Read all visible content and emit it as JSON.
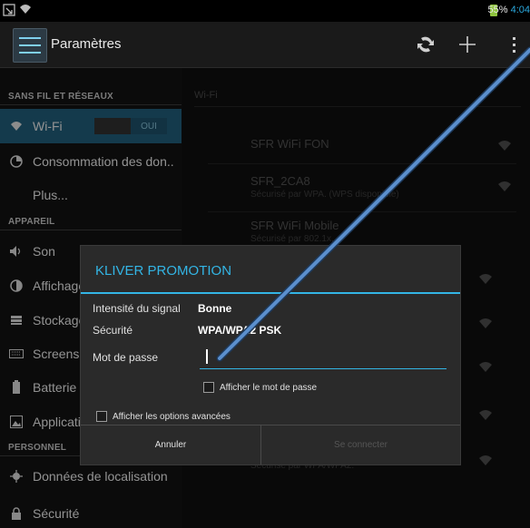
{
  "status_bar": {
    "battery": "55%",
    "time": "4:04"
  },
  "action_bar": {
    "title": "Paramètres",
    "icons": [
      "settings-app-icon",
      "sync-icon",
      "add-icon",
      "overflow-menu-icon"
    ]
  },
  "left_pane": {
    "section_wireless": "SANS FIL ET RÉSEAUX",
    "wifi_label": "Wi-Fi",
    "wifi_toggle": "OUI",
    "data_usage": "Consommation des don..",
    "more": "Plus...",
    "section_device": "APPAREIL",
    "sound": "Son",
    "display": "Affichage",
    "storage": "Stockage",
    "screenshot": "Screenshot",
    "battery": "Batterie",
    "apps": "Applications",
    "section_personal": "PERSONNEL",
    "location": "Données de localisation",
    "security": "Sécurité"
  },
  "right_pane": {
    "header": "Wi-Fi",
    "networks": [
      {
        "name": "SFR WiFi FON",
        "sub": ""
      },
      {
        "name": "SFR_2CA8",
        "sub": "Sécurisé par WPA. (WPS disponible)"
      },
      {
        "name": "SFR WiFi Mobile",
        "sub": "Sécurisé par 802.1x."
      },
      {
        "name": "",
        "sub": "Sécurisé par WPA/WPA2."
      }
    ]
  },
  "dialog": {
    "title": "KLIVER PROMOTION",
    "signal_label": "Intensité du signal",
    "signal_value": "Bonne",
    "security_label": "Sécurité",
    "security_value": "WPA/WPA2 PSK",
    "password_label": "Mot de passe",
    "password_value": "",
    "show_password": "Afficher le mot de passe",
    "show_advanced": "Afficher les options avancées",
    "cancel": "Annuler",
    "connect": "Se connecter"
  },
  "colors": {
    "accent": "#33b5e5",
    "selected_item": "#1f5a76",
    "annotation_arrow": "#4f86c6"
  }
}
